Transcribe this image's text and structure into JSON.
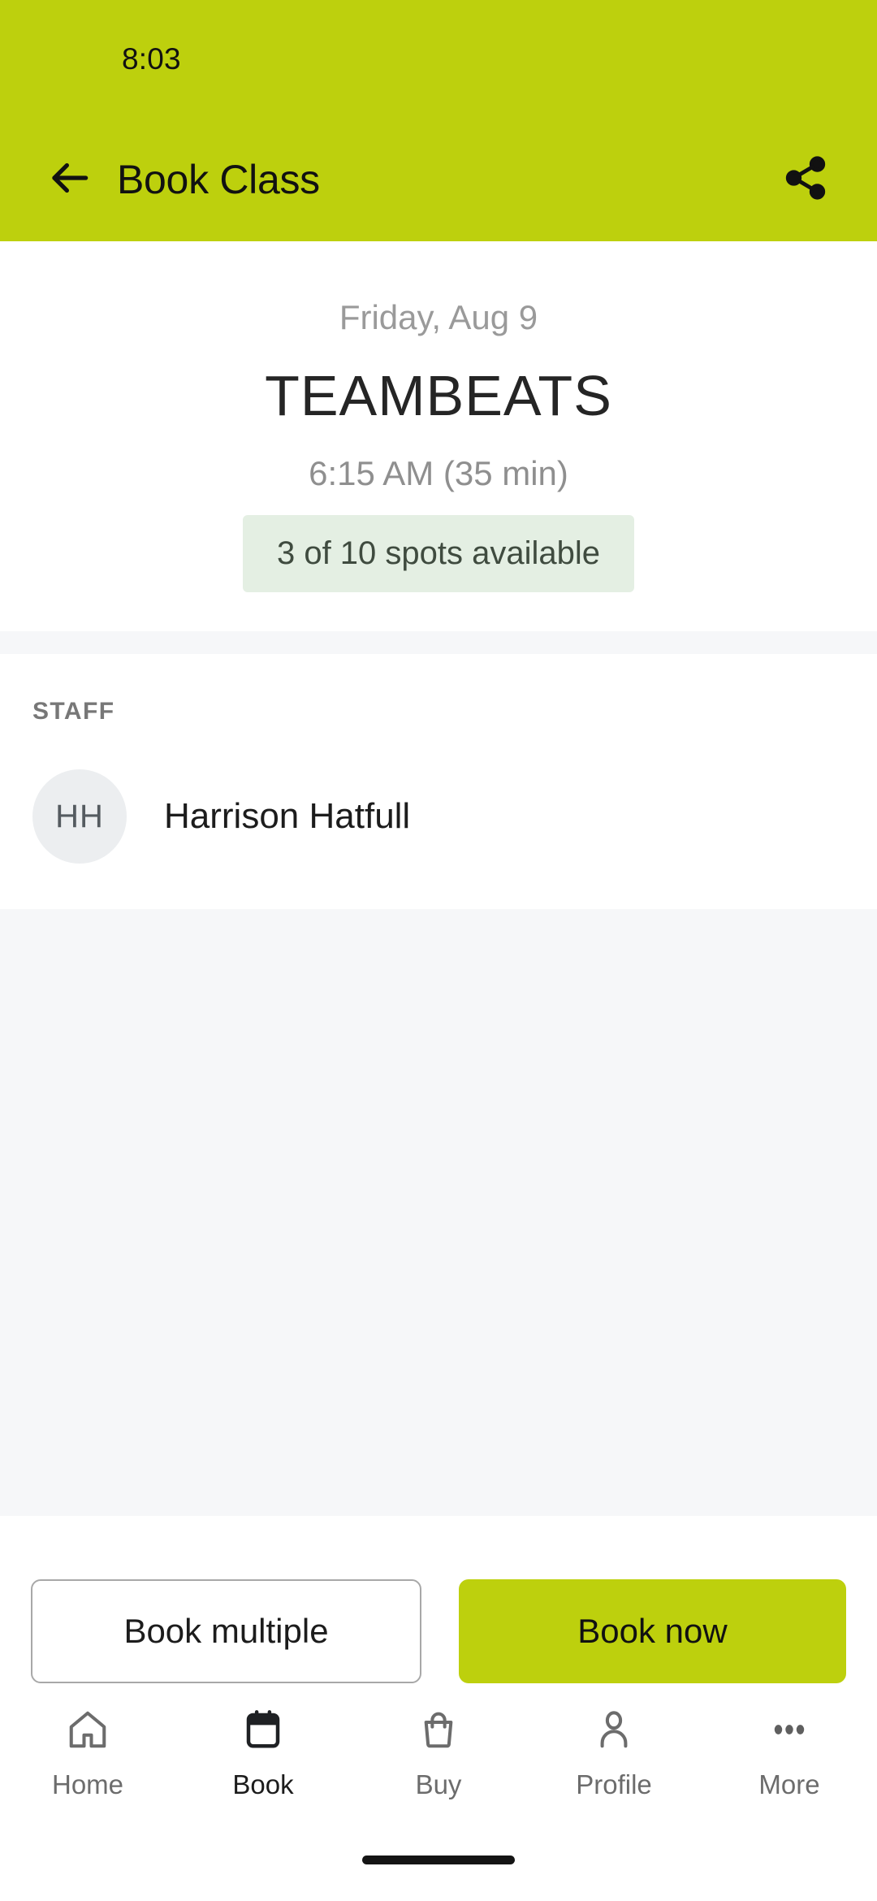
{
  "status_bar": {
    "clock": "8:03"
  },
  "app_bar": {
    "title": "Book Class",
    "back_icon": "arrow-left-icon",
    "share_icon": "share-icon",
    "background_color": "#bdd00d"
  },
  "class_summary": {
    "date": "Friday, Aug 9",
    "name": "TEAMBEATS",
    "time": "6:15 AM (35 min)",
    "spots": "3 of 10 spots available",
    "spots_badge_color": "#e4efe3"
  },
  "staff": {
    "section_label": "STAFF",
    "members": [
      {
        "initials": "HH",
        "name": "Harrison Hatfull"
      }
    ]
  },
  "actions": {
    "secondary_label": "Book multiple",
    "primary_label": "Book now",
    "primary_color": "#bdd00d"
  },
  "bottom_nav": {
    "items": [
      {
        "label": "Home",
        "icon": "home-icon",
        "active": false
      },
      {
        "label": "Book",
        "icon": "calendar-icon",
        "active": true
      },
      {
        "label": "Buy",
        "icon": "shopping-bag-icon",
        "active": false
      },
      {
        "label": "Profile",
        "icon": "person-icon",
        "active": false
      },
      {
        "label": "More",
        "icon": "more-dots-icon",
        "active": false
      }
    ]
  }
}
